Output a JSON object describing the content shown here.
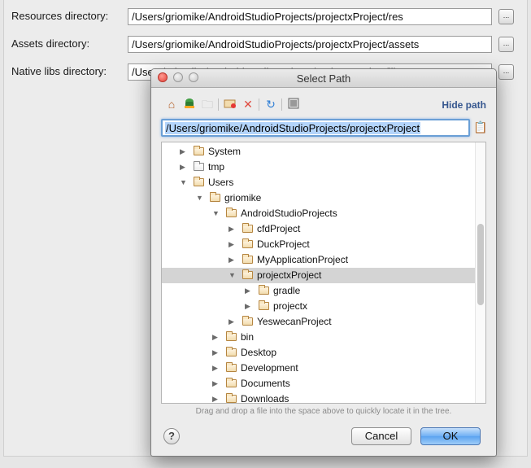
{
  "settings": {
    "rows": [
      {
        "label": "Resources directory:",
        "value": "/Users/griomike/AndroidStudioProjects/projectxProject/res"
      },
      {
        "label": "Assets directory:",
        "value": "/Users/griomike/AndroidStudioProjects/projectxProject/assets"
      },
      {
        "label": "Native libs directory:",
        "value": "/Users/griomike/AndroidStudioProjects/projectxProject/libs"
      }
    ],
    "browse_label": "..."
  },
  "dialog": {
    "title": "Select Path",
    "toolbar": {
      "icons": [
        "home-icon",
        "android-icon",
        "new-folder-disabled-icon",
        "new-folder-icon",
        "delete-icon",
        "refresh-icon",
        "show-hidden-icon"
      ],
      "hide_path_label": "Hide path"
    },
    "path_value": "/Users/griomike/AndroidStudioProjects/projectxProject",
    "tree": {
      "nodes": [
        {
          "label": "System",
          "expanded": false
        },
        {
          "label": "tmp",
          "expanded": false,
          "link": true
        },
        {
          "label": "Users",
          "expanded": true
        },
        {
          "label": "griomike",
          "expanded": true
        },
        {
          "label": "AndroidStudioProjects",
          "expanded": true
        },
        {
          "label": "cfdProject",
          "expanded": false
        },
        {
          "label": "DuckProject",
          "expanded": false
        },
        {
          "label": "MyApplicationProject",
          "expanded": false
        },
        {
          "label": "projectxProject",
          "expanded": true,
          "selected": true
        },
        {
          "label": "gradle",
          "expanded": false
        },
        {
          "label": "projectx",
          "expanded": false
        },
        {
          "label": "YeswecanProject",
          "expanded": false
        },
        {
          "label": "bin",
          "expanded": false
        },
        {
          "label": "Desktop",
          "expanded": false
        },
        {
          "label": "Development",
          "expanded": false
        },
        {
          "label": "Documents",
          "expanded": false
        },
        {
          "label": "Downloads",
          "expanded": false
        }
      ]
    },
    "hint": "Drag and drop a file into the space above to quickly locate it in the tree.",
    "help_label": "?",
    "cancel_label": "Cancel",
    "ok_label": "OK"
  },
  "colors": {
    "accent": "#5ba3f0",
    "link": "#36578f",
    "selection": "#d4d4d4",
    "path_highlight": "#b3d4fb"
  }
}
